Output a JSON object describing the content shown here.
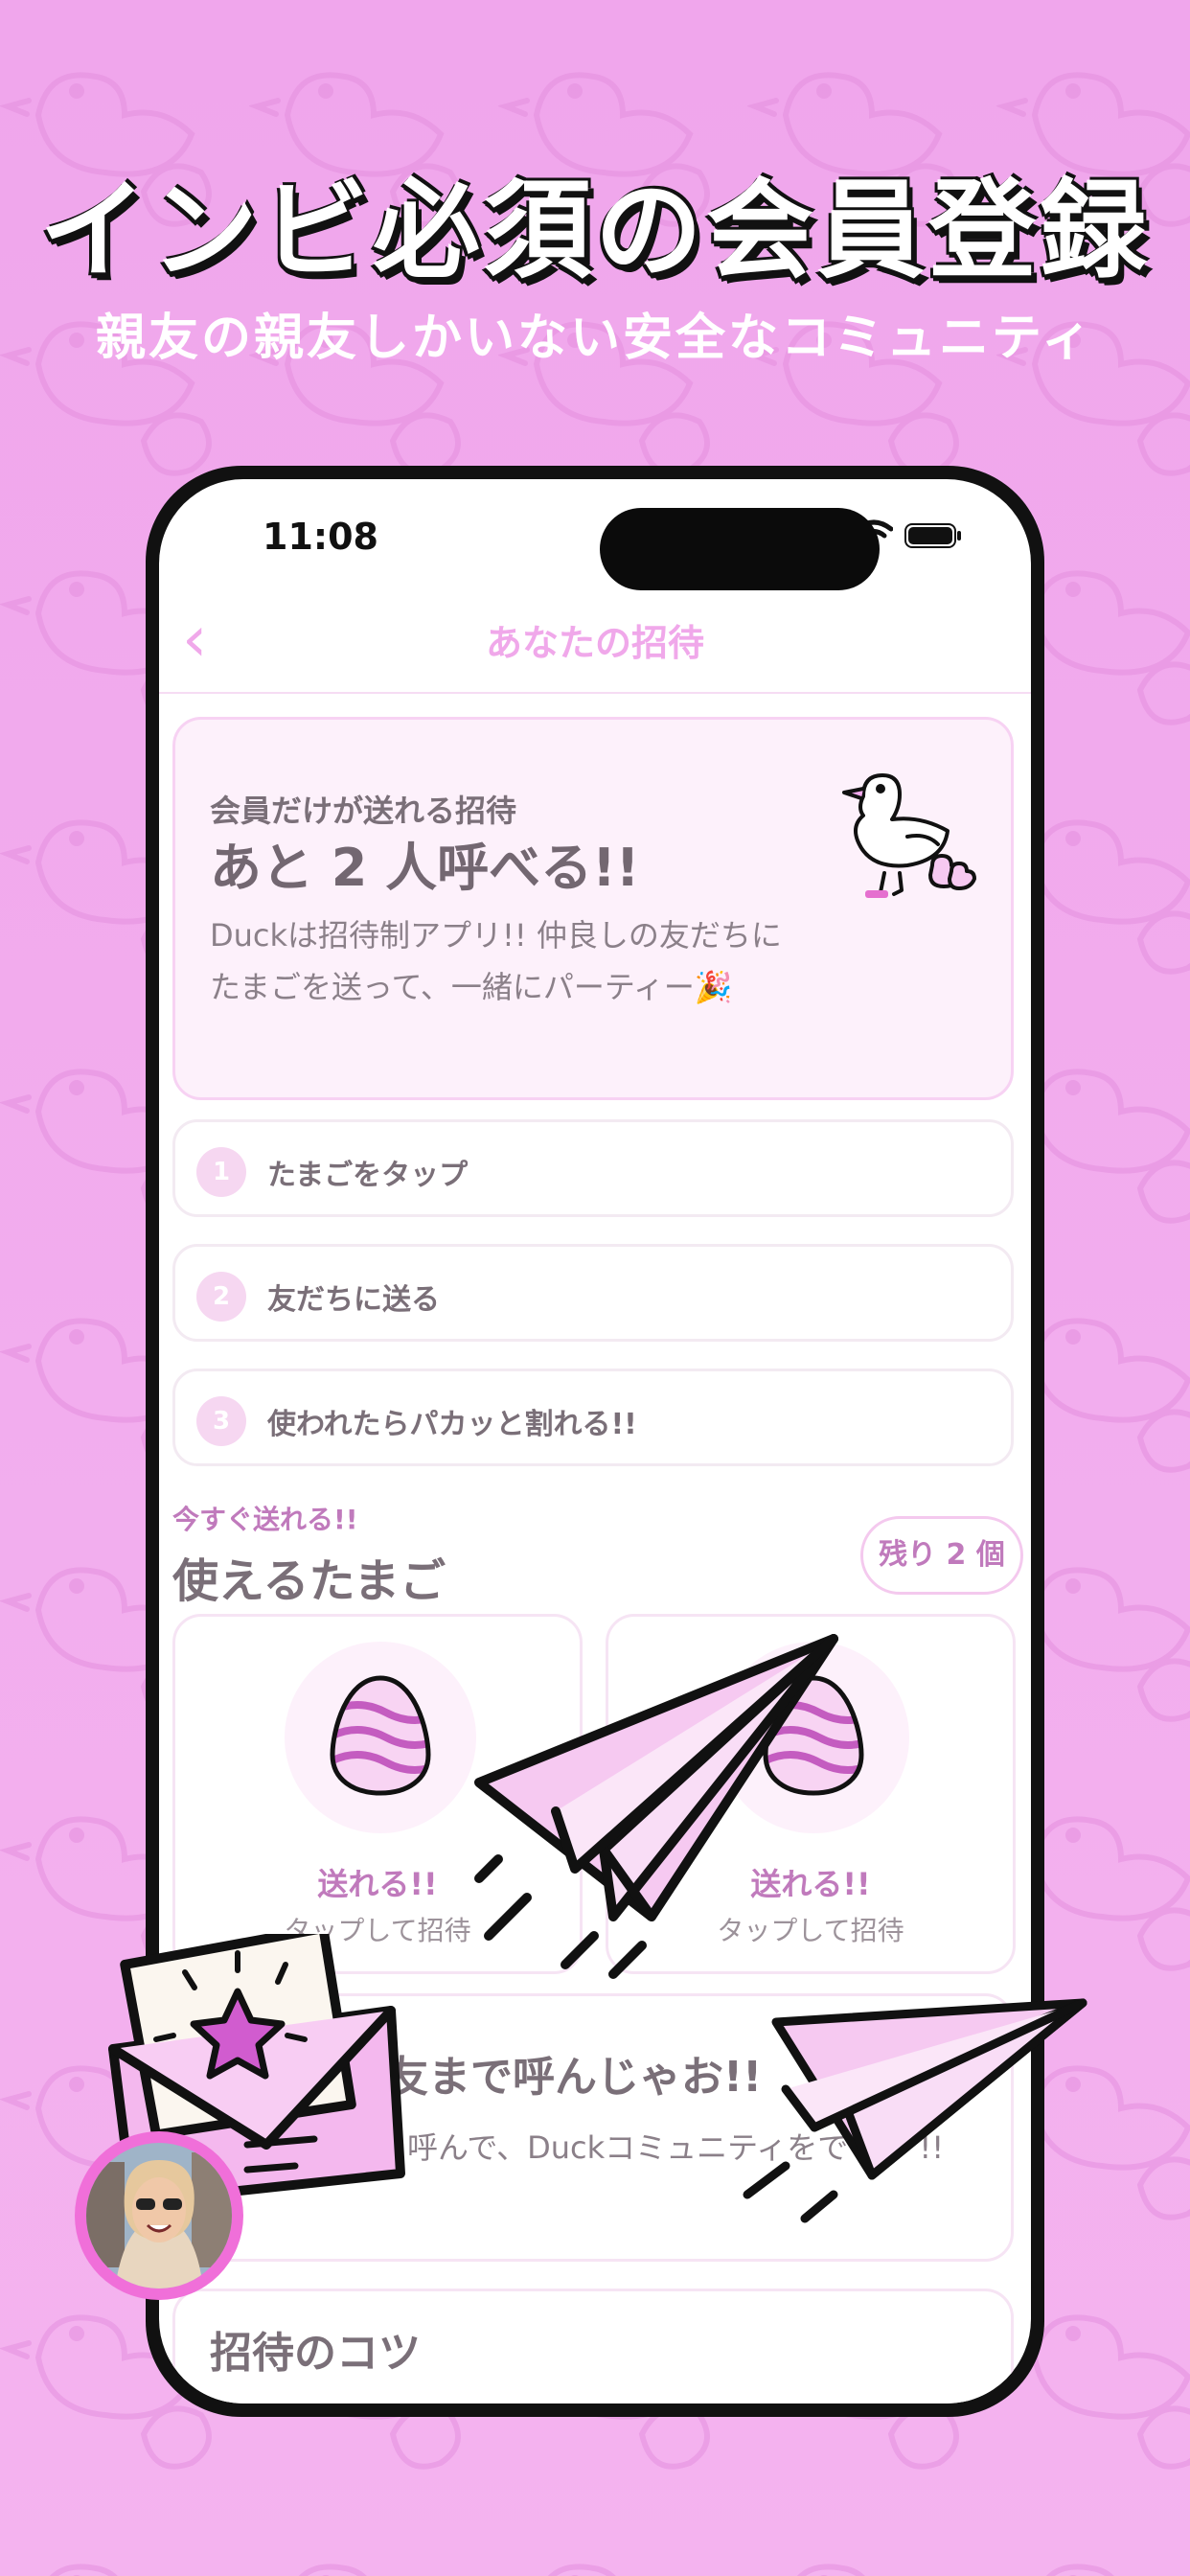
{
  "hero": {
    "headline": "インビ必須の会員登録",
    "subheadline": "親友の親友しかいない安全なコミュニティ"
  },
  "status_bar": {
    "time": "11:08",
    "wifi_icon": "wifi-icon",
    "battery_icon": "battery-icon"
  },
  "nav": {
    "back_icon": "chevron-left-icon",
    "back_symbol": "‹",
    "title": "あなたの招待"
  },
  "invite_card": {
    "kicker": "会員だけが送れる招待",
    "title": "あと 2 人呼べる!!",
    "description": "Duckは招待制アプリ!! 仲良しの友だちにたまごを送って、一緒にパーティー🎉",
    "illustration": "duck-family-icon"
  },
  "steps": [
    {
      "number": "1",
      "label": "たまごをタップ"
    },
    {
      "number": "2",
      "label": "友だちに送る"
    },
    {
      "number": "3",
      "label": "使われたらパカッと割れる!!"
    }
  ],
  "eggs_section": {
    "kicker": "今すぐ送れる!!",
    "title": "使えるたまご",
    "remaining_badge": "残り 2 個",
    "eggs": [
      {
        "status": "送れる!!",
        "hint": "タップして招待"
      },
      {
        "status": "送れる!!",
        "hint": "タップして招待"
      }
    ]
  },
  "promo": {
    "title": "友まで呼んじゃお!!",
    "body": "を呼んで、Duckコミュニティをでっか !!"
  },
  "tips": {
    "title": "招待のコツ"
  },
  "decorations": {
    "paper_plane_icon": "paper-plane-icon",
    "envelope_icon": "envelope-star-icon",
    "avatar": "user-avatar"
  },
  "colors": {
    "background": "#f3a9ee",
    "accent": "#f0a8ea",
    "accent_dark": "#c07abc",
    "text_muted": "#7a6f78"
  }
}
